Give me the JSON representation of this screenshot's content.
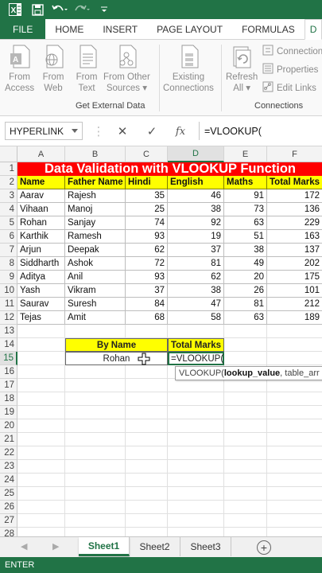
{
  "ribbon": {
    "tabs": [
      "FILE",
      "HOME",
      "INSERT",
      "PAGE LAYOUT",
      "FORMULAS",
      "D"
    ],
    "buttons": [
      {
        "label1": "From",
        "label2": "Access"
      },
      {
        "label1": "From",
        "label2": "Web"
      },
      {
        "label1": "From",
        "label2": "Text"
      },
      {
        "label1": "From Other",
        "label2": "Sources ▾"
      },
      {
        "label1": "Existing",
        "label2": "Connections"
      },
      {
        "label1": "Refresh",
        "label2": "All ▾"
      }
    ],
    "group_get_external": "Get External Data",
    "group_connections": "Connections",
    "connections_items": [
      "Connections",
      "Properties",
      "Edit Links"
    ]
  },
  "formula_bar": {
    "name_box": "HYPERLINK",
    "formula": "=VLOOKUP("
  },
  "grid": {
    "columns": [
      "A",
      "B",
      "C",
      "D",
      "E",
      "F"
    ],
    "rows": [
      "1",
      "2",
      "3",
      "4",
      "5",
      "6",
      "7",
      "8",
      "9",
      "10",
      "11",
      "12",
      "13",
      "14",
      "15",
      "16",
      "17",
      "18",
      "19",
      "20",
      "21",
      "22",
      "23",
      "24",
      "25",
      "26",
      "27",
      "28"
    ],
    "title": "Data Validation with VLOOKUP Function",
    "headers": [
      "Name",
      "Father Name",
      "Hindi",
      "English",
      "Maths",
      "Total Marks"
    ],
    "data": [
      [
        "Aarav",
        "Rajesh",
        "35",
        "46",
        "91",
        "172"
      ],
      [
        "Vihaan",
        "Manoj",
        "25",
        "38",
        "73",
        "136"
      ],
      [
        "Rohan",
        "Sanjay",
        "74",
        "92",
        "63",
        "229"
      ],
      [
        "Karthik",
        "Ramesh",
        "93",
        "19",
        "51",
        "163"
      ],
      [
        "Arjun",
        "Deepak",
        "62",
        "37",
        "38",
        "137"
      ],
      [
        "Siddharth",
        "Ashok",
        "72",
        "81",
        "49",
        "202"
      ],
      [
        "Aditya",
        "Anil",
        "93",
        "62",
        "20",
        "175"
      ],
      [
        "Yash",
        "Vikram",
        "37",
        "38",
        "26",
        "101"
      ],
      [
        "Saurav",
        "Suresh",
        "84",
        "47",
        "81",
        "212"
      ],
      [
        "Tejas",
        "Amit",
        "68",
        "58",
        "63",
        "189"
      ]
    ],
    "lookup": {
      "by_name_label": "By Name",
      "total_marks_label": "Total Marks",
      "name_value": "Rohan",
      "formula_value": "=VLOOKUP("
    },
    "tooltip": {
      "fn": "VLOOKUP(",
      "arg1": "lookup_value",
      "rest": ", table_arr"
    }
  },
  "sheets": [
    "Sheet1",
    "Sheet2",
    "Sheet3"
  ],
  "status": "ENTER",
  "colors": {
    "excel_green": "#217346",
    "title_red": "#ff0000",
    "header_yellow": "#ffff00"
  }
}
